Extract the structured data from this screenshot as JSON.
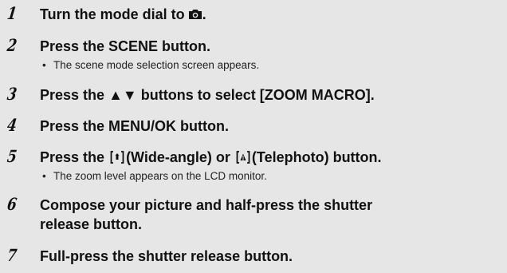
{
  "steps": [
    {
      "number": "1",
      "text_before": "Turn the mode dial to",
      "icon": "camera-icon",
      "text_after": "."
    },
    {
      "number": "2",
      "text": "Press the SCENE button.",
      "sub": "The scene mode selection screen appears."
    },
    {
      "number": "3",
      "text_before": "Press the",
      "arrows": "▲▼",
      "text_after": "buttons to select [ZOOM MACRO]."
    },
    {
      "number": "4",
      "text": "Press the MENU/OK button."
    },
    {
      "number": "5",
      "text_before": "Press the",
      "icon_wide": "wide-angle-icon",
      "text_mid": "(Wide-angle) or",
      "icon_tele": "telephoto-icon",
      "text_after": "(Telephoto) button.",
      "sub": "The zoom level appears on the LCD monitor."
    },
    {
      "number": "6",
      "line1": "Compose your picture and half-press the shutter",
      "line2": "release button."
    },
    {
      "number": "7",
      "text": "Full-press the shutter release button."
    }
  ],
  "bullet": "•"
}
